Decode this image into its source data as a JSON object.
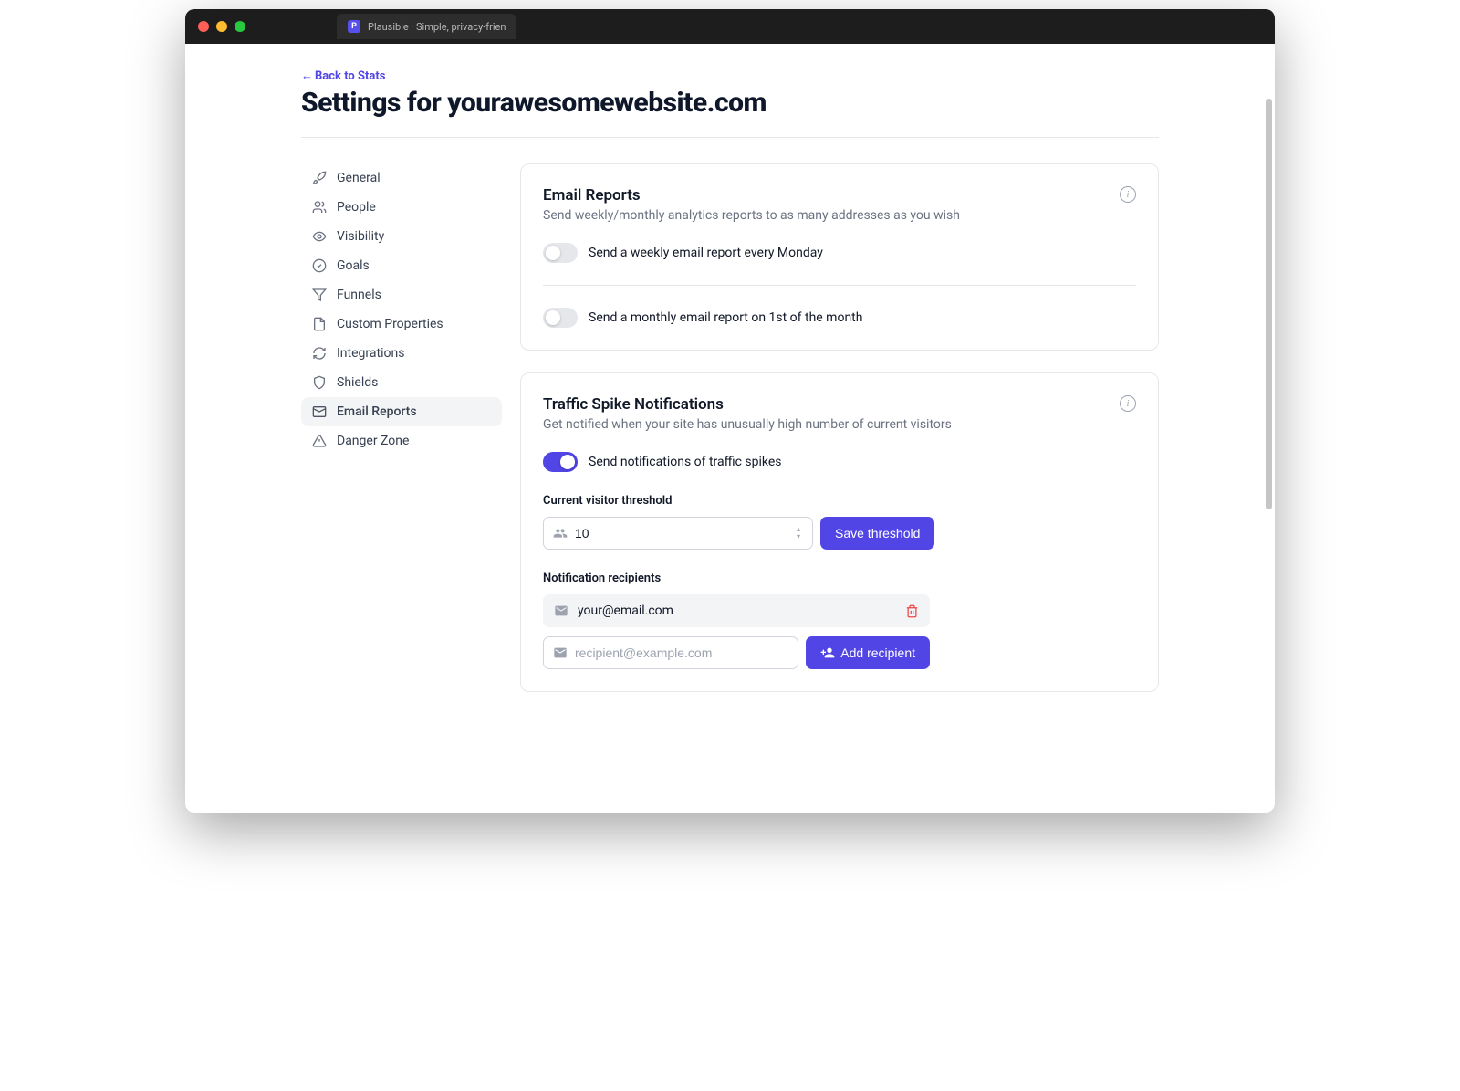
{
  "browser": {
    "tab_title": "Plausible · Simple, privacy-frien"
  },
  "header": {
    "back_link": "Back to Stats",
    "title": "Settings for yourawesomewebsite.com"
  },
  "sidebar": {
    "items": [
      {
        "label": "General"
      },
      {
        "label": "People"
      },
      {
        "label": "Visibility"
      },
      {
        "label": "Goals"
      },
      {
        "label": "Funnels"
      },
      {
        "label": "Custom Properties"
      },
      {
        "label": "Integrations"
      },
      {
        "label": "Shields"
      },
      {
        "label": "Email Reports"
      },
      {
        "label": "Danger Zone"
      }
    ],
    "active_index": 8
  },
  "email_reports": {
    "title": "Email Reports",
    "subtitle": "Send weekly/monthly analytics reports to as many addresses as you wish",
    "weekly_label": "Send a weekly email report every Monday",
    "weekly_enabled": false,
    "monthly_label": "Send a monthly email report on 1st of the month",
    "monthly_enabled": false
  },
  "traffic_spike": {
    "title": "Traffic Spike Notifications",
    "subtitle": "Get notified when your site has unusually high number of current visitors",
    "toggle_label": "Send notifications of traffic spikes",
    "enabled": true,
    "threshold_label": "Current visitor threshold",
    "threshold_value": "10",
    "save_threshold_btn": "Save threshold",
    "recipients_label": "Notification recipients",
    "recipients": [
      {
        "email": "your@email.com"
      }
    ],
    "recipient_placeholder": "recipient@example.com",
    "add_recipient_btn": "Add recipient"
  }
}
